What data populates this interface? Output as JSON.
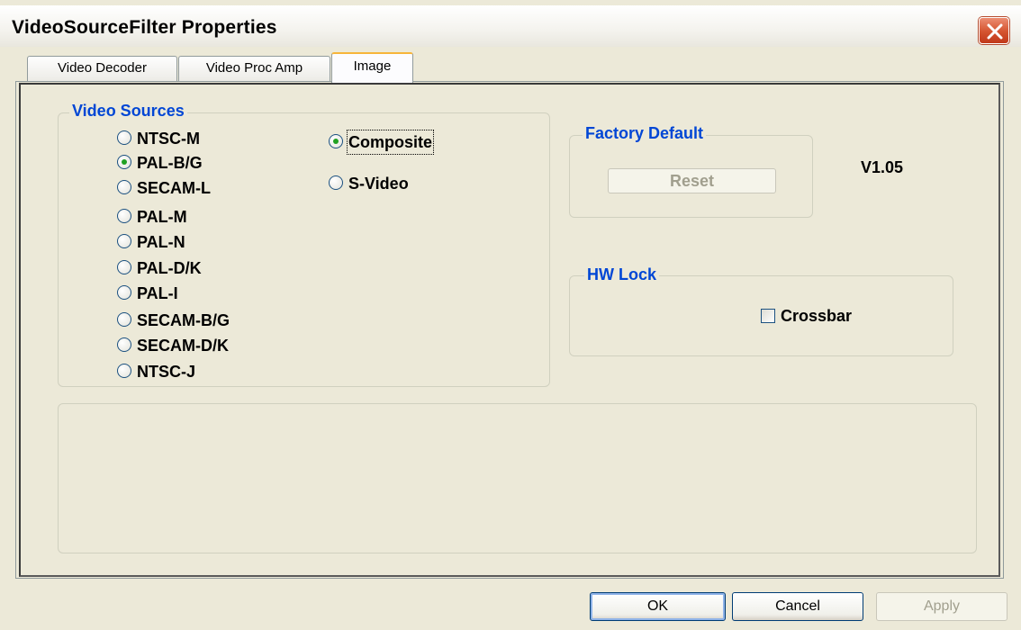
{
  "window": {
    "title": "VideoSourceFilter Properties"
  },
  "tabs": [
    {
      "label": "Video Decoder",
      "active": false
    },
    {
      "label": "Video Proc Amp",
      "active": false
    },
    {
      "label": "Image",
      "active": true
    }
  ],
  "video_sources": {
    "legend": "Video Sources",
    "standards": [
      {
        "label": "NTSC-M",
        "selected": false
      },
      {
        "label": "PAL-B/G",
        "selected": true
      },
      {
        "label": "SECAM-L",
        "selected": false
      },
      {
        "label": "PAL-M",
        "selected": false
      },
      {
        "label": "PAL-N",
        "selected": false
      },
      {
        "label": "PAL-D/K",
        "selected": false
      },
      {
        "label": "PAL-I",
        "selected": false
      },
      {
        "label": "SECAM-B/G",
        "selected": false
      },
      {
        "label": "SECAM-D/K",
        "selected": false
      },
      {
        "label": "NTSC-J",
        "selected": false
      }
    ],
    "inputs": [
      {
        "label": "Composite",
        "selected": true
      },
      {
        "label": "S-Video",
        "selected": false
      }
    ]
  },
  "factory_default": {
    "legend": "Factory Default",
    "reset_label": "Reset",
    "reset_enabled": false
  },
  "version": "V1.05",
  "hw_lock": {
    "legend": "HW Lock",
    "crossbar_label": "Crossbar",
    "crossbar_checked": false
  },
  "buttons": {
    "ok": "OK",
    "cancel": "Cancel",
    "apply": "Apply"
  },
  "colors": {
    "accent": "#0046d5",
    "tab_highlight": "#f7b53a",
    "radio_dot": "#21a121",
    "close_button": "#d4532f"
  },
  "icons": {
    "close": "close-icon"
  }
}
